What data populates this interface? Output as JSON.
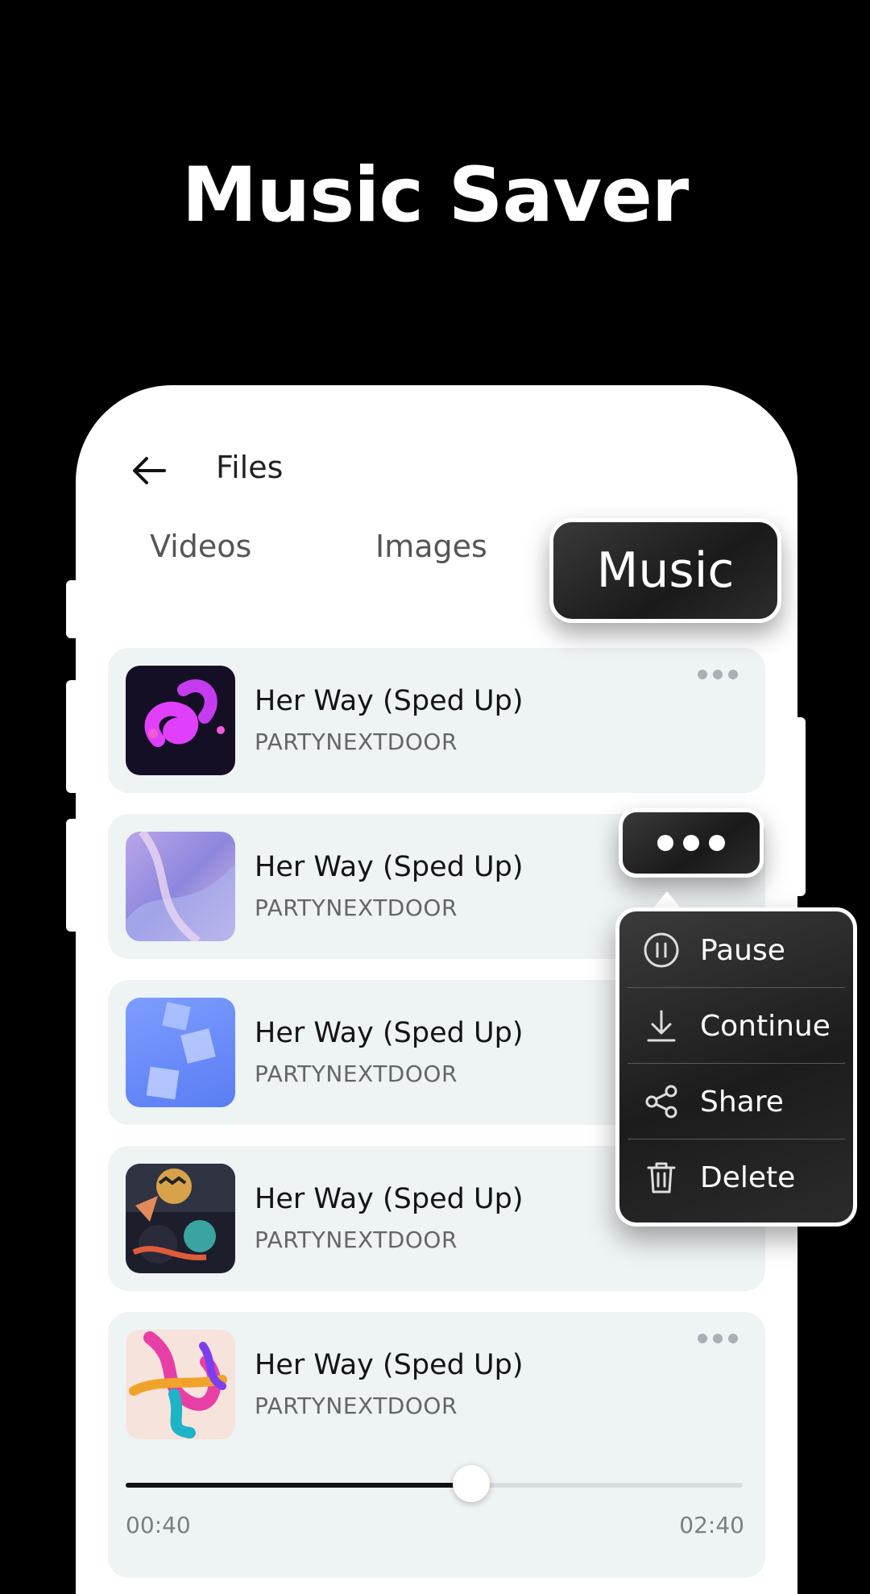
{
  "headline": "Music Saver",
  "header": {
    "title": "Files",
    "back_icon": "arrow-left-icon"
  },
  "tabs": [
    {
      "label": "Videos",
      "active": false
    },
    {
      "label": "Images",
      "active": false
    },
    {
      "label": "Music",
      "active": true
    }
  ],
  "tracks": [
    {
      "title": "Her Way (Sped Up)",
      "artist": "PARTYNEXTDOOR",
      "art": "pink-swirl"
    },
    {
      "title": "Her Way (Sped Up)",
      "artist": "PARTYNEXTDOOR",
      "art": "purple-wave"
    },
    {
      "title": "Her Way (Sped Up)",
      "artist": "PARTYNEXTDOOR",
      "art": "blue-cubes"
    },
    {
      "title": "Her Way (Sped Up)",
      "artist": "PARTYNEXTDOOR",
      "art": "dark-shapes"
    },
    {
      "title": "Her Way (Sped Up)",
      "artist": "PARTYNEXTDOOR",
      "art": "colorful-knot"
    }
  ],
  "player": {
    "current_time": "00:40",
    "total_time": "02:40",
    "progress": 0.56
  },
  "context_menu": {
    "items": [
      {
        "label": "Pause",
        "icon": "pause-icon"
      },
      {
        "label": "Continue",
        "icon": "download-icon"
      },
      {
        "label": "Share",
        "icon": "share-icon"
      },
      {
        "label": "Delete",
        "icon": "trash-icon"
      }
    ]
  },
  "colors": {
    "background": "#000000",
    "card": "#eef3f4",
    "menu": "#222222"
  }
}
